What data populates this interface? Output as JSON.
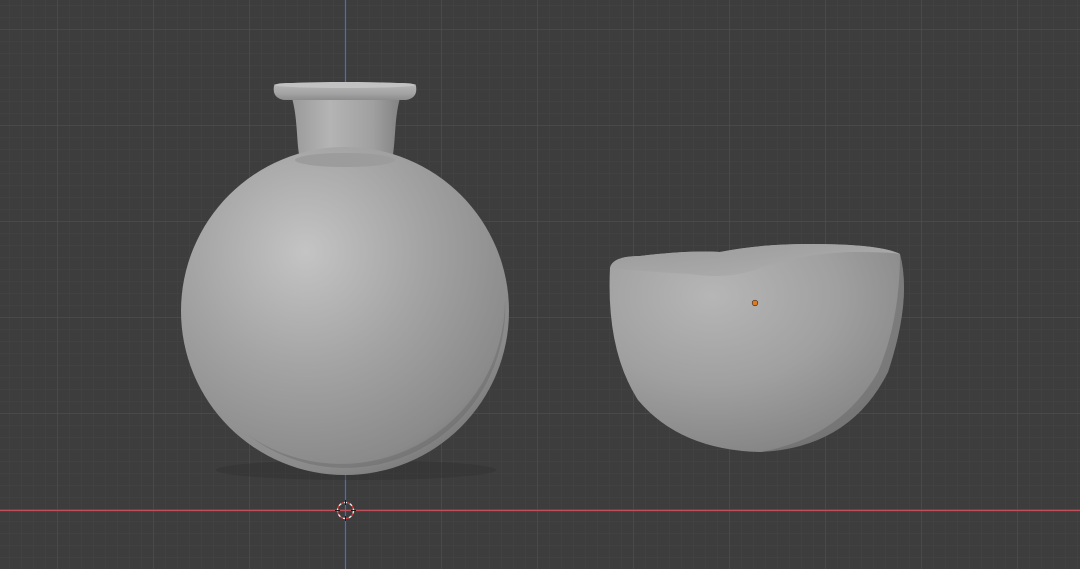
{
  "viewport": {
    "background": "#3d3d3d",
    "axis_colors": {
      "x_axis": "#c1505a",
      "z_axis": "#3f6fd1"
    },
    "origin_marker_color": "#e07a1f",
    "mesh_color": "#a9a9a9"
  },
  "objects": [
    {
      "name": "flask",
      "type": "mesh",
      "selected": false
    },
    {
      "name": "bowl",
      "type": "mesh",
      "selected": false
    }
  ],
  "icons": {
    "cursor": "3d-cursor-icon",
    "origin": "object-origin-icon"
  }
}
